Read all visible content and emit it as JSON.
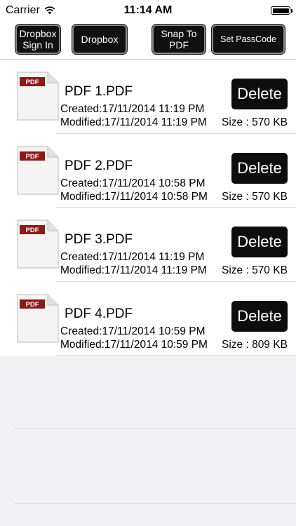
{
  "status_bar": {
    "carrier": "Carrier",
    "time": "11:14 AM",
    "battery_level": 1.0
  },
  "toolbar": {
    "dropbox_sign_in": "Dropbox\nSign In",
    "dropbox": "Dropbox",
    "snap_to_pdf": "Snap To\nPDF",
    "set_passcode": "Set PassCode"
  },
  "icons": {
    "wifi": "wifi-icon",
    "battery": "battery-icon",
    "pdf": "pdf-file-icon",
    "pdf_badge_text": "PDF"
  },
  "colors": {
    "button_bg": "#101010",
    "pdf_badge": "#8b1a1a",
    "empty_bg": "#f2f2f4"
  },
  "files": [
    {
      "name": "PDF 1.PDF",
      "created": "Created:17/11/2014 11:19 PM",
      "modified": "Modified:17/11/2014 11:19 PM",
      "size": "Size : 570 KB",
      "delete_label": "Delete"
    },
    {
      "name": "PDF 2.PDF",
      "created": "Created:17/11/2014 10:58 PM",
      "modified": "Modified:17/11/2014 10:58 PM",
      "size": "Size : 570 KB",
      "delete_label": "Delete"
    },
    {
      "name": "PDF 3.PDF",
      "created": "Created:17/11/2014 11:19 PM",
      "modified": "Modified:17/11/2014 11:19 PM",
      "size": "Size : 570 KB",
      "delete_label": "Delete"
    },
    {
      "name": "PDF 4.PDF",
      "created": "Created:17/11/2014 10:59 PM",
      "modified": "Modified:17/11/2014 10:59 PM",
      "size": "Size : 809 KB",
      "delete_label": "Delete"
    }
  ]
}
